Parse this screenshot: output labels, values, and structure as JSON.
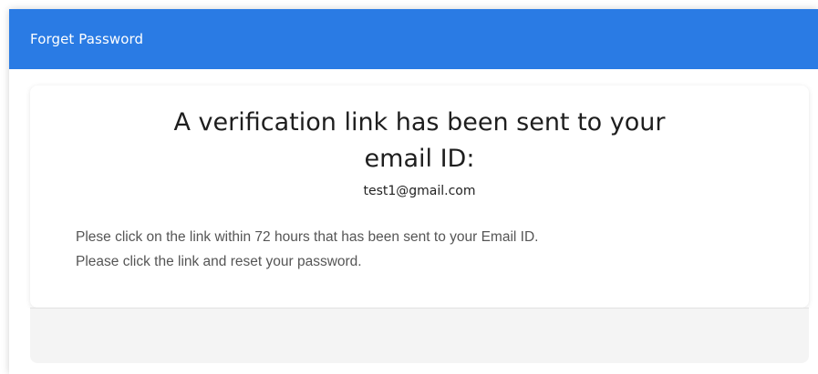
{
  "header": {
    "title": "Forget Password",
    "color": "#2a7be4"
  },
  "card": {
    "heading_line1": "A verification link has been sent to your",
    "heading_line2": "email ID:",
    "email": "test1@gmail.com",
    "message_line1": "Plese click on the link within 72 hours that has been sent to your Email ID.",
    "message_line2": "Please click the link and reset your password."
  }
}
